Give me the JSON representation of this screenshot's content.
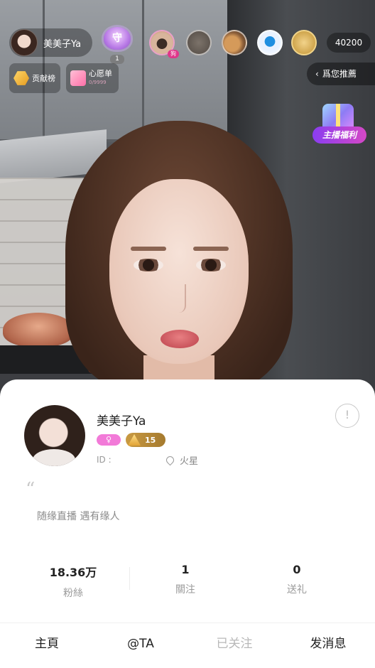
{
  "overlay": {
    "host_name": "美美子Ya",
    "guard_count": "1",
    "guard_glyph": "守",
    "viewer_tag": "狗",
    "audience_count": "40200",
    "contrib_label": "贡献榜",
    "wishlist_label": "心愿单",
    "wishlist_progress": "0/9999",
    "recommend_label": "爲您推薦",
    "recommend_arrow": "‹",
    "welfare_label": "主播福利"
  },
  "profile": {
    "name": "美美子Ya",
    "gender_glyph": "♀",
    "level": "15",
    "id_label": "ID :",
    "location": "火星",
    "quote_glyph": "“",
    "bio": "随缘直播 遇有缘人",
    "report_glyph": "!"
  },
  "stats": {
    "fans_value": "18.36万",
    "fans_label": "粉絲",
    "following_value": "1",
    "following_label": "關注",
    "gifts_value": "0",
    "gifts_label": "送礼"
  },
  "tabs": {
    "home": "主頁",
    "mention": "@TA",
    "followed": "已关注",
    "message": "发消息"
  }
}
